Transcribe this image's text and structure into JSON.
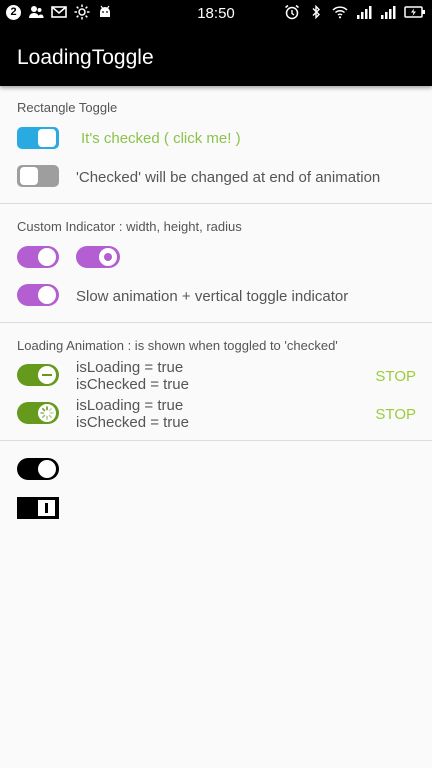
{
  "status_bar": {
    "notification_count": "2",
    "time": "18:50"
  },
  "app": {
    "title": "LoadingToggle"
  },
  "sections": {
    "rectangle": {
      "title": "Rectangle Toggle",
      "row1_label": "It's checked ( click me! )",
      "row2_label": "'Checked' will be changed at end of animation"
    },
    "custom": {
      "title": "Custom Indicator : width, height, radius",
      "row2_label": "Slow animation + vertical toggle indicator"
    },
    "loading": {
      "title": "Loading Animation : is shown when toggled to 'checked'",
      "rows": [
        {
          "line1": "isLoading = true",
          "line2": "isChecked = true",
          "action": "STOP"
        },
        {
          "line1": "isLoading = true",
          "line2": "isChecked = true",
          "action": "STOP"
        }
      ]
    }
  },
  "colors": {
    "blue": "#29abe2",
    "gray": "#9e9e9e",
    "purple": "#b35fd1",
    "green": "#659a1c",
    "black": "#000000",
    "label_green": "#8bc34a"
  }
}
